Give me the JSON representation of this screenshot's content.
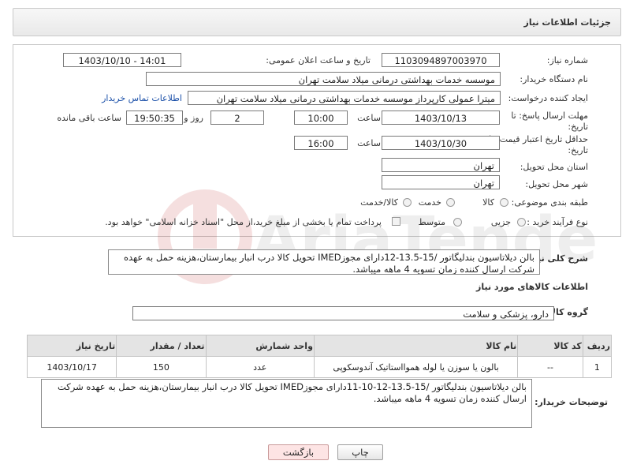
{
  "header": {
    "title": "جزئیات اطلاعات نیاز"
  },
  "form": {
    "need_number_label": "شماره نیاز:",
    "need_number": "1103094897003970",
    "announce_label": "تاریخ و ساعت اعلان عمومی:",
    "announce_value": "1403/10/10 - 14:01",
    "buyer_label": "نام دستگاه خریدار:",
    "buyer_value": "موسسه خدمات بهداشتی درمانی میلاد سلامت تهران",
    "creator_label": "ایجاد کننده درخواست:",
    "creator_value": "میترا عمولی کارپرداز موسسه خدمات بهداشتی درمانی میلاد سلامت تهران",
    "contact_link": "اطلاعات تماس خریدار",
    "reply_deadline_label": "مهلت ارسال پاسخ: تا تاریخ:",
    "reply_date": "1403/10/13",
    "time_label": "ساعت",
    "reply_time": "10:00",
    "days_value": "2",
    "days_label": "روز و",
    "remaining_time": "19:50:35",
    "remaining_label": "ساعت باقی مانده",
    "price_validity_label": "حداقل تاریخ اعتبار قیمت: تا تاریخ:",
    "price_date": "1403/10/30",
    "price_time_label": "ساعت",
    "price_time": "16:00",
    "province_label": "استان محل تحویل:",
    "province_value": "تهران",
    "city_label": "شهر محل تحویل:",
    "city_value": "تهران",
    "category_label": "طبقه بندی موضوعی:",
    "category_options": [
      "کالا",
      "خدمت",
      "کالا/خدمت"
    ],
    "process_label": "نوع فرآیند خرید :",
    "process_options": [
      "جزیی",
      "متوسط"
    ],
    "payment_note": "پرداخت تمام یا بخشی از مبلغ خرید،از محل \"اسناد خزانه اسلامی\" خواهد بود."
  },
  "description": {
    "label": "شرح کلی نیاز:",
    "text": "بالن دیلاتاسیون بندلیگاتور /15-13.5-12دارای مجوزIMED تحویل کالا درب انبار بیمارستان،هزینه حمل به عهده شرکت ارسال کننده زمان تسویه 4 ماهه میباشد."
  },
  "goods": {
    "section_title": "اطلاعات کالاهای مورد نیاز",
    "group_label": "گروه کالا:",
    "group_value": "دارو، پزشکی و سلامت",
    "columns": [
      "ردیف",
      "کد کالا",
      "نام کالا",
      "واحد شمارش",
      "تعداد / مقدار",
      "تاریخ نیاز"
    ],
    "rows": [
      [
        "1",
        "--",
        "بالون یا سوزن یا لوله هموااستاتیک آندوسکوپی",
        "عدد",
        "150",
        "1403/10/17"
      ]
    ]
  },
  "buyer_notes": {
    "label": "توضیحات خریدار:",
    "text": "بالن دیلاتاسیون بندلیگاتور /15-13.5-12-10-11دارای مجوزIMED تحویل کالا درب انبار بیمارستان،هزینه حمل به عهده شرکت ارسال کننده زمان تسویه 4 ماهه میباشد."
  },
  "buttons": {
    "print": "چاپ",
    "back": "بازگشت"
  },
  "watermark": {
    "text": "AriaTender.neT"
  }
}
